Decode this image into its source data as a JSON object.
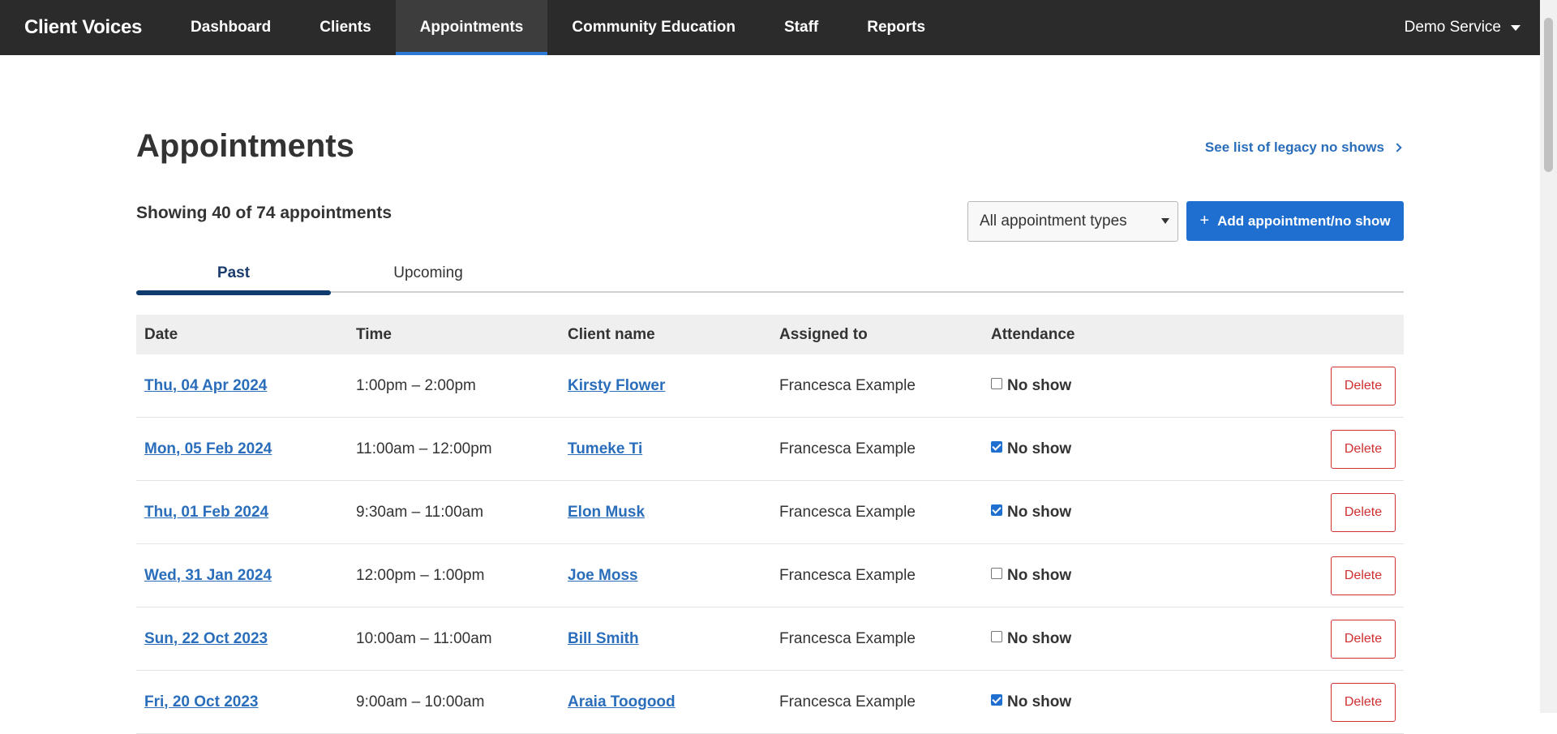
{
  "nav": {
    "brand": "Client Voices",
    "links": [
      {
        "label": "Dashboard"
      },
      {
        "label": "Clients"
      },
      {
        "label": "Appointments"
      },
      {
        "label": "Community Education"
      },
      {
        "label": "Staff"
      },
      {
        "label": "Reports"
      }
    ],
    "active": "Appointments",
    "service": "Demo Service"
  },
  "page": {
    "title": "Appointments",
    "legacy_link": "See list of legacy no shows",
    "showing": "Showing 40 of 74 appointments",
    "filter_selected": "All appointment types",
    "add_button": "Add appointment/no show",
    "tabs": [
      {
        "label": "Past"
      },
      {
        "label": "Upcoming"
      }
    ],
    "active_tab": "Past"
  },
  "table": {
    "headers": {
      "date": "Date",
      "time": "Time",
      "client": "Client name",
      "assigned": "Assigned to",
      "attendance": "Attendance"
    },
    "rows": [
      {
        "date": "Thu, 04 Apr 2024",
        "time": "1:00pm – 2:00pm",
        "client": "Kirsty Flower",
        "assigned": "Francesca Example",
        "no_show": false,
        "no_show_label": "No show",
        "delete_label": "Delete"
      },
      {
        "date": "Mon, 05 Feb 2024",
        "time": "11:00am – 12:00pm",
        "client": "Tumeke Ti",
        "assigned": "Francesca Example",
        "no_show": true,
        "no_show_label": "No show",
        "delete_label": "Delete"
      },
      {
        "date": "Thu, 01 Feb 2024",
        "time": "9:30am – 11:00am",
        "client": "Elon Musk",
        "assigned": "Francesca Example",
        "no_show": true,
        "no_show_label": "No show",
        "delete_label": "Delete"
      },
      {
        "date": "Wed, 31 Jan 2024",
        "time": "12:00pm – 1:00pm",
        "client": "Joe Moss",
        "assigned": "Francesca Example",
        "no_show": false,
        "no_show_label": "No show",
        "delete_label": "Delete"
      },
      {
        "date": "Sun, 22 Oct 2023",
        "time": "10:00am – 11:00am",
        "client": "Bill Smith",
        "assigned": "Francesca Example",
        "no_show": false,
        "no_show_label": "No show",
        "delete_label": "Delete"
      },
      {
        "date": "Fri, 20 Oct 2023",
        "time": "9:00am – 10:00am",
        "client": "Araia Toogood",
        "assigned": "Francesca Example",
        "no_show": true,
        "no_show_label": "No show",
        "delete_label": "Delete"
      }
    ]
  },
  "colors": {
    "nav_bg": "#2b2b2b",
    "accent": "#1f6fd0",
    "link": "#2a6ebb",
    "danger": "#d02f2f",
    "tab_active": "#0f3b6e"
  }
}
